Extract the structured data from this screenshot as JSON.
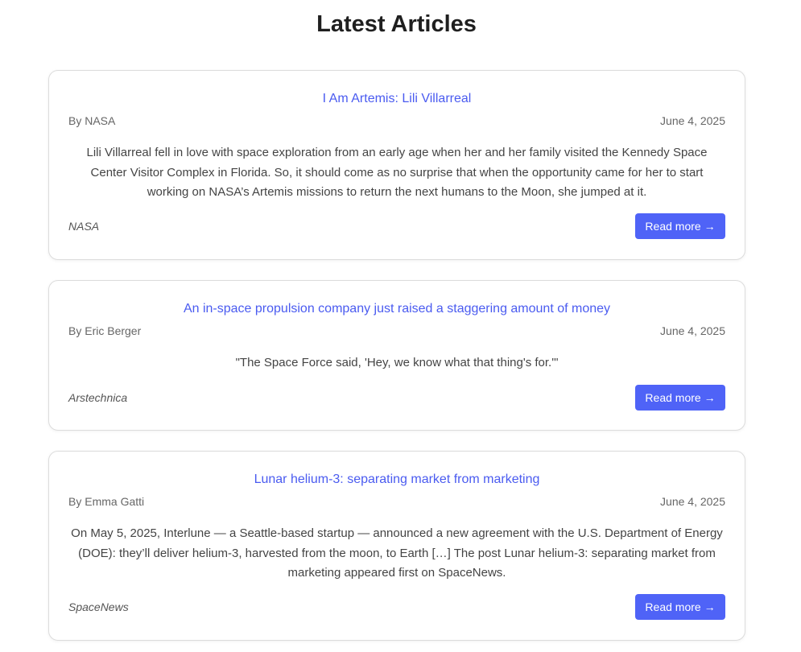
{
  "page": {
    "title": "Latest Articles"
  },
  "articles": [
    {
      "title": "I Am Artemis: Lili Villarreal",
      "author": "By NASA",
      "date": "June 4, 2025",
      "summary": "Lili Villarreal fell in love with space exploration from an early age when her and her family visited the Kennedy Space Center Visitor Complex in Florida. So, it should come as no surprise that when the opportunity came for her to start working on NASA’s Artemis missions to return the next humans to the Moon, she jumped at it.",
      "source": "NASA",
      "read_more_label": "Read more →"
    },
    {
      "title": "An in-space propulsion company just raised a staggering amount of money",
      "author": "By Eric Berger",
      "date": "June 4, 2025",
      "summary": "\"The Space Force said, 'Hey, we know what that thing's for.'\"",
      "source": "Arstechnica",
      "read_more_label": "Read more →"
    },
    {
      "title": "Lunar helium-3: separating market from marketing",
      "author": "By Emma Gatti",
      "date": "June 4, 2025",
      "summary": "On May 5, 2025, Interlune — a Seattle-based startup — announced a new agreement with the U.S. Department of Energy (DOE): they’ll deliver helium-3, harvested from the moon, to Earth […] The post Lunar helium-3: separating market from marketing appeared first on SpaceNews.",
      "source": "SpaceNews",
      "read_more_label": "Read more →"
    }
  ],
  "colors": {
    "accent": "#4f63f7",
    "link": "#4a5bf0",
    "text": "#444444",
    "muted": "#666666"
  }
}
